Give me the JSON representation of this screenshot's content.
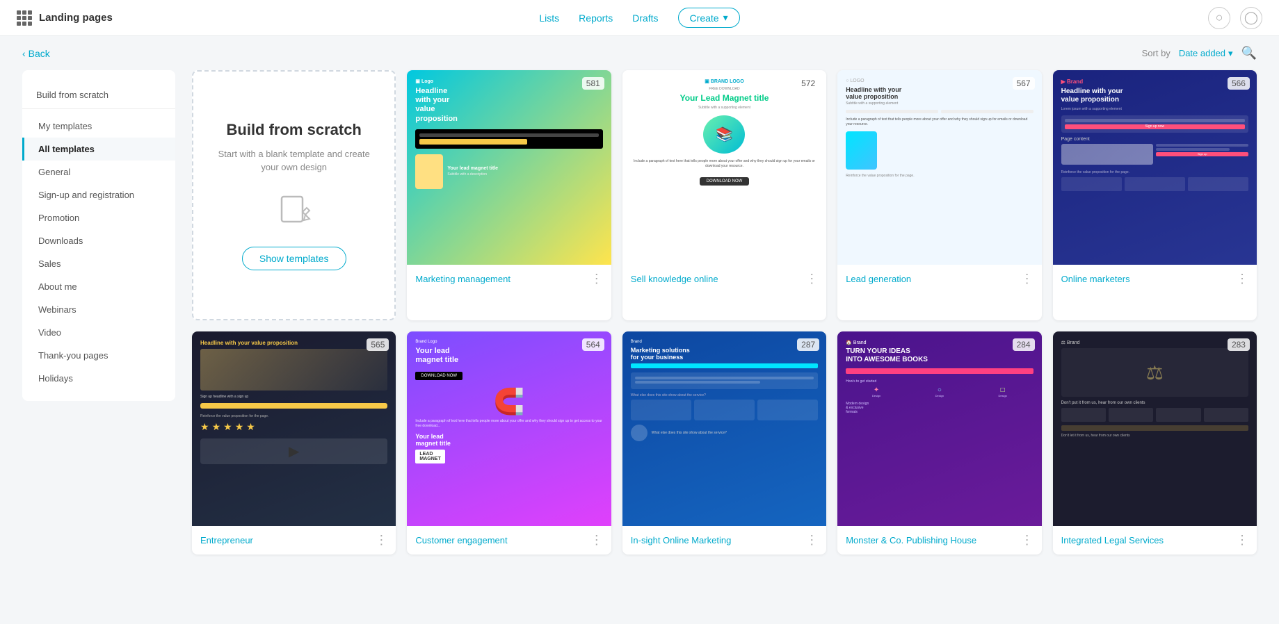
{
  "topnav": {
    "app_title": "Landing pages",
    "links": [
      "Lists",
      "Reports",
      "Drafts"
    ],
    "create_label": "Create",
    "create_arrow": "▾"
  },
  "subheader": {
    "back_label": "Back",
    "sort_label": "Sort by",
    "sort_value": "Date added",
    "sort_arrow": "▾"
  },
  "sidebar": {
    "build_label": "Build from scratch",
    "items": [
      {
        "id": "my-templates",
        "label": "My templates"
      },
      {
        "id": "all-templates",
        "label": "All templates",
        "active": true
      },
      {
        "id": "general",
        "label": "General"
      },
      {
        "id": "sign-up",
        "label": "Sign-up and registration"
      },
      {
        "id": "promotion",
        "label": "Promotion"
      },
      {
        "id": "downloads",
        "label": "Downloads"
      },
      {
        "id": "sales",
        "label": "Sales"
      },
      {
        "id": "about-me",
        "label": "About me"
      },
      {
        "id": "webinars",
        "label": "Webinars"
      },
      {
        "id": "video",
        "label": "Video"
      },
      {
        "id": "thank-you",
        "label": "Thank-you pages"
      },
      {
        "id": "holidays",
        "label": "Holidays"
      }
    ]
  },
  "scratch_card": {
    "title": "Build from scratch",
    "description": "Start with a blank template and create your own design",
    "button_label": "Show templates"
  },
  "templates": {
    "row1": [
      {
        "id": "marketing-management",
        "name": "Marketing management",
        "count": "581",
        "color": "tpl-1"
      },
      {
        "id": "sell-knowledge",
        "name": "Sell knowledge online",
        "count": "572",
        "color": "tpl-2"
      },
      {
        "id": "lead-generation",
        "name": "Lead generation",
        "count": "567",
        "color": "tpl-3"
      },
      {
        "id": "online-marketers",
        "name": "Online marketers",
        "count": "566",
        "color": "tpl-4"
      }
    ],
    "row2": [
      {
        "id": "entrepreneur",
        "name": "Entrepreneur",
        "count": "565",
        "color": "tpl-5"
      },
      {
        "id": "customer-engagement",
        "name": "Customer engagement",
        "count": "564",
        "color": "tpl-6"
      },
      {
        "id": "in-sight",
        "name": "In-sight Online Marketing",
        "count": "287",
        "color": "tpl-7"
      },
      {
        "id": "monster-co",
        "name": "Monster & Co. Publishing House",
        "count": "284",
        "color": "tpl-8"
      },
      {
        "id": "integrated-legal",
        "name": "Integrated Legal Services",
        "count": "283",
        "color": "tpl-9"
      }
    ]
  },
  "icons": {
    "grid": "⊞",
    "back_arrow": "‹",
    "search": "🔍",
    "menu_dots": "⋮",
    "pencil_box": "✏",
    "chevron_down": "▾"
  }
}
